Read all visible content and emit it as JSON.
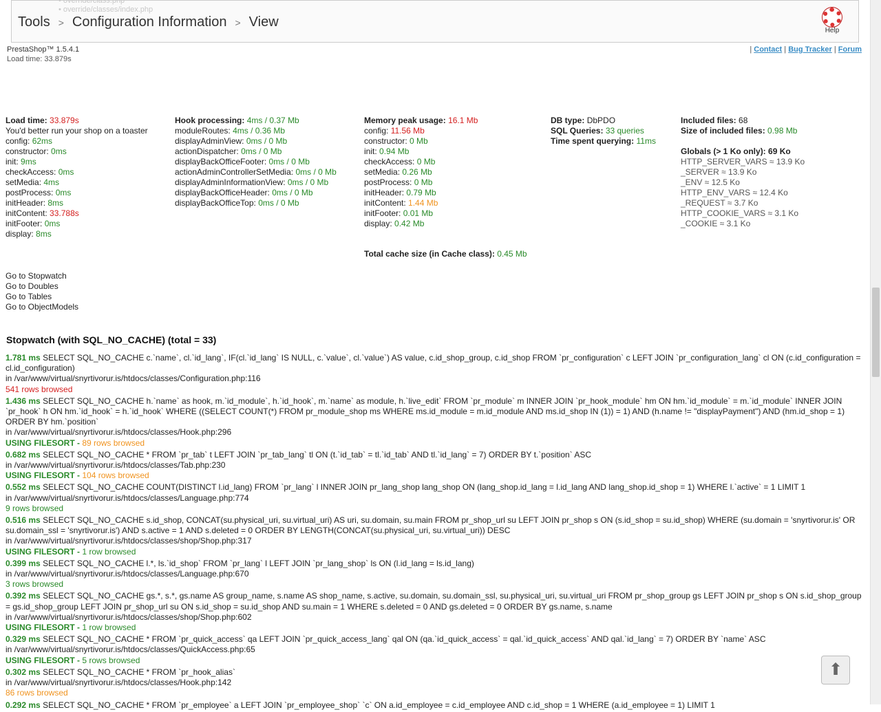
{
  "header": {
    "ghost_lines": [
      "• override/class.php",
      "• override/classes/index.php"
    ],
    "breadcrumb": [
      "Tools",
      "Configuration Information",
      "View"
    ],
    "help_label": "Help"
  },
  "meta": {
    "version": "PrestaShop™ 1.5.4.1",
    "load_time": "Load time: 33.879s",
    "links": [
      "Contact",
      "Bug Tracker",
      "Forum"
    ]
  },
  "col1": {
    "load_label": "Load time:",
    "load_value": "33.879s",
    "toaster": "You'd better run your shop on a toaster",
    "rows": [
      {
        "k": "config:",
        "v": "62ms",
        "c": "g"
      },
      {
        "k": "constructor:",
        "v": "0ms",
        "c": "g"
      },
      {
        "k": "init:",
        "v": "9ms",
        "c": "g"
      },
      {
        "k": "checkAccess:",
        "v": "0ms",
        "c": "g"
      },
      {
        "k": "setMedia:",
        "v": "4ms",
        "c": "g"
      },
      {
        "k": "postProcess:",
        "v": "0ms",
        "c": "g"
      },
      {
        "k": "initHeader:",
        "v": "8ms",
        "c": "g"
      },
      {
        "k": "initContent:",
        "v": "33.788s",
        "c": "r"
      },
      {
        "k": "initFooter:",
        "v": "0ms",
        "c": "g"
      },
      {
        "k": "display:",
        "v": "8ms",
        "c": "g"
      }
    ]
  },
  "col2": {
    "label": "Hook processing:",
    "value": "4ms / 0.37 Mb",
    "rows": [
      {
        "k": "moduleRoutes:",
        "v": "4ms / 0.36 Mb"
      },
      {
        "k": "displayAdminView:",
        "v": "0ms / 0 Mb"
      },
      {
        "k": "actionDispatcher:",
        "v": "0ms / 0 Mb"
      },
      {
        "k": "displayBackOfficeFooter:",
        "v": "0ms / 0 Mb"
      },
      {
        "k": "actionAdminControllerSetMedia:",
        "v": "0ms / 0 Mb"
      },
      {
        "k": "displayAdminInformationView:",
        "v": "0ms / 0 Mb"
      },
      {
        "k": "displayBackOfficeHeader:",
        "v": "0ms / 0 Mb"
      },
      {
        "k": "displayBackOfficeTop:",
        "v": "0ms / 0 Mb"
      }
    ]
  },
  "col3": {
    "label": "Memory peak usage:",
    "value": "16.1 Mb",
    "rows": [
      {
        "k": "config:",
        "v": "11.56 Mb",
        "c": "r"
      },
      {
        "k": "constructor:",
        "v": "0 Mb",
        "c": "g"
      },
      {
        "k": "init:",
        "v": "0.94 Mb",
        "c": "g"
      },
      {
        "k": "checkAccess:",
        "v": "0 Mb",
        "c": "g"
      },
      {
        "k": "setMedia:",
        "v": "0.26 Mb",
        "c": "g"
      },
      {
        "k": "postProcess:",
        "v": "0 Mb",
        "c": "g"
      },
      {
        "k": "initHeader:",
        "v": "0.79 Mb",
        "c": "g"
      },
      {
        "k": "initContent:",
        "v": "1.44 Mb",
        "c": "o"
      },
      {
        "k": "initFooter:",
        "v": "0.01 Mb",
        "c": "g"
      },
      {
        "k": "display:",
        "v": "0.42 Mb",
        "c": "g"
      }
    ],
    "cache_label": "Total cache size (in Cache class):",
    "cache_value": "0.45 Mb"
  },
  "col4": {
    "db_label": "DB type:",
    "db_value": "DbPDO",
    "sql_label": "SQL Queries:",
    "sql_value": "33 queries",
    "time_label": "Time spent querying:",
    "time_value": "11ms"
  },
  "col5": {
    "inc_label": "Included files:",
    "inc_value": "68",
    "size_label": "Size of included files:",
    "size_value": "0.98 Mb",
    "globals_label": "Globals (> 1 Ko only): 69 Ko",
    "globals": [
      "HTTP_SERVER_VARS ≈ 13.9 Ko",
      "_SERVER ≈ 13.9 Ko",
      "_ENV ≈ 12.5 Ko",
      "HTTP_ENV_VARS ≈ 12.4 Ko",
      "_REQUEST ≈ 3.7 Ko",
      "HTTP_COOKIE_VARS ≈ 3.1 Ko",
      "_COOKIE ≈ 3.1 Ko"
    ]
  },
  "nav": [
    "Go to Stopwatch",
    "Go to Doubles",
    "Go to Tables",
    "Go to ObjectModels"
  ],
  "stopwatch_title": "Stopwatch (with SQL_NO_CACHE) (total = 33)",
  "queries": [
    {
      "time": "1.781 ms",
      "sql": "SELECT SQL_NO_CACHE c.`name`, cl.`id_lang`, IF(cl.`id_lang` IS NULL, c.`value`, cl.`value`) AS value, c.id_shop_group, c.id_shop FROM `pr_configuration` c LEFT JOIN `pr_configuration_lang` cl ON (c.id_configuration = cl.id_configuration)",
      "file": "in /var/www/virtual/snyrtivorur.is/htdocs/classes/Configuration.php:116",
      "filesort": "",
      "rows": "541 rows browsed",
      "rc": "r"
    },
    {
      "time": "1.436 ms",
      "sql": "SELECT SQL_NO_CACHE h.`name` as hook, m.`id_module`, h.`id_hook`, m.`name` as module, h.`live_edit` FROM `pr_module` m INNER JOIN `pr_hook_module` hm ON hm.`id_module` = m.`id_module` INNER JOIN `pr_hook` h ON hm.`id_hook` = h.`id_hook` WHERE ((SELECT COUNT(*) FROM pr_module_shop ms WHERE ms.id_module = m.id_module AND ms.id_shop IN (1)) = 1) AND (h.name != \"displayPayment\") AND (hm.id_shop = 1) ORDER BY hm.`position`",
      "file": "in /var/www/virtual/snyrtivorur.is/htdocs/classes/Hook.php:296",
      "filesort": "USING FILESORT - ",
      "rows": "89 rows browsed",
      "rc": "o"
    },
    {
      "time": "0.682 ms",
      "sql": "SELECT SQL_NO_CACHE * FROM `pr_tab` t LEFT JOIN `pr_tab_lang` tl ON (t.`id_tab` = tl.`id_tab` AND tl.`id_lang` = 7) ORDER BY t.`position` ASC",
      "file": "in /var/www/virtual/snyrtivorur.is/htdocs/classes/Tab.php:230",
      "filesort": "USING FILESORT - ",
      "rows": "104 rows browsed",
      "rc": "o"
    },
    {
      "time": "0.552 ms",
      "sql": "SELECT SQL_NO_CACHE COUNT(DISTINCT l.id_lang) FROM `pr_lang` l INNER JOIN pr_lang_shop lang_shop ON (lang_shop.id_lang = l.id_lang AND lang_shop.id_shop = 1) WHERE l.`active` = 1 LIMIT 1",
      "file": "in /var/www/virtual/snyrtivorur.is/htdocs/classes/Language.php:774",
      "filesort": "",
      "rows": "9 rows browsed",
      "rc": "g"
    },
    {
      "time": "0.516 ms",
      "sql": "SELECT SQL_NO_CACHE s.id_shop, CONCAT(su.physical_uri, su.virtual_uri) AS uri, su.domain, su.main FROM pr_shop_url su LEFT JOIN pr_shop s ON (s.id_shop = su.id_shop) WHERE (su.domain = 'snyrtivorur.is' OR su.domain_ssl = 'snyrtivorur.is') AND s.active = 1 AND s.deleted = 0 ORDER BY LENGTH(CONCAT(su.physical_uri, su.virtual_uri)) DESC",
      "file": "in /var/www/virtual/snyrtivorur.is/htdocs/classes/shop/Shop.php:317",
      "filesort": "USING FILESORT - ",
      "rows": "1 row browsed",
      "rc": "g"
    },
    {
      "time": "0.399 ms",
      "sql": "SELECT SQL_NO_CACHE l.*, ls.`id_shop` FROM `pr_lang` l LEFT JOIN `pr_lang_shop` ls ON (l.id_lang = ls.id_lang)",
      "file": "in /var/www/virtual/snyrtivorur.is/htdocs/classes/Language.php:670",
      "filesort": "",
      "rows": "3 rows browsed",
      "rc": "g"
    },
    {
      "time": "0.392 ms",
      "sql": "SELECT SQL_NO_CACHE gs.*, s.*, gs.name AS group_name, s.name AS shop_name, s.active, su.domain, su.domain_ssl, su.physical_uri, su.virtual_uri FROM pr_shop_group gs LEFT JOIN pr_shop s ON s.id_shop_group = gs.id_shop_group LEFT JOIN pr_shop_url su ON s.id_shop = su.id_shop AND su.main = 1 WHERE s.deleted = 0 AND gs.deleted = 0 ORDER BY gs.name, s.name",
      "file": "in /var/www/virtual/snyrtivorur.is/htdocs/classes/shop/Shop.php:602",
      "filesort": "USING FILESORT - ",
      "rows": "1 row browsed",
      "rc": "g"
    },
    {
      "time": "0.329 ms",
      "sql": "SELECT SQL_NO_CACHE * FROM `pr_quick_access` qa LEFT JOIN `pr_quick_access_lang` qal ON (qa.`id_quick_access` = qal.`id_quick_access` AND qal.`id_lang` = 7) ORDER BY `name` ASC",
      "file": "in /var/www/virtual/snyrtivorur.is/htdocs/classes/QuickAccess.php:65",
      "filesort": "USING FILESORT - ",
      "rows": "5 rows browsed",
      "rc": "g"
    },
    {
      "time": "0.302 ms",
      "sql": "SELECT SQL_NO_CACHE * FROM `pr_hook_alias`",
      "file": "in /var/www/virtual/snyrtivorur.is/htdocs/classes/Hook.php:142",
      "filesort": "",
      "rows": "86 rows browsed",
      "rc": "o"
    },
    {
      "time": "0.292 ms",
      "sql": "SELECT SQL_NO_CACHE * FROM `pr_employee` a LEFT JOIN `pr_employee_shop` `c` ON a.id_employee = c.id_employee AND c.id_shop = 1 WHERE (a.id_employee = 1) LIMIT 1",
      "file": "",
      "filesort": "",
      "rows": "",
      "rc": "g"
    }
  ]
}
